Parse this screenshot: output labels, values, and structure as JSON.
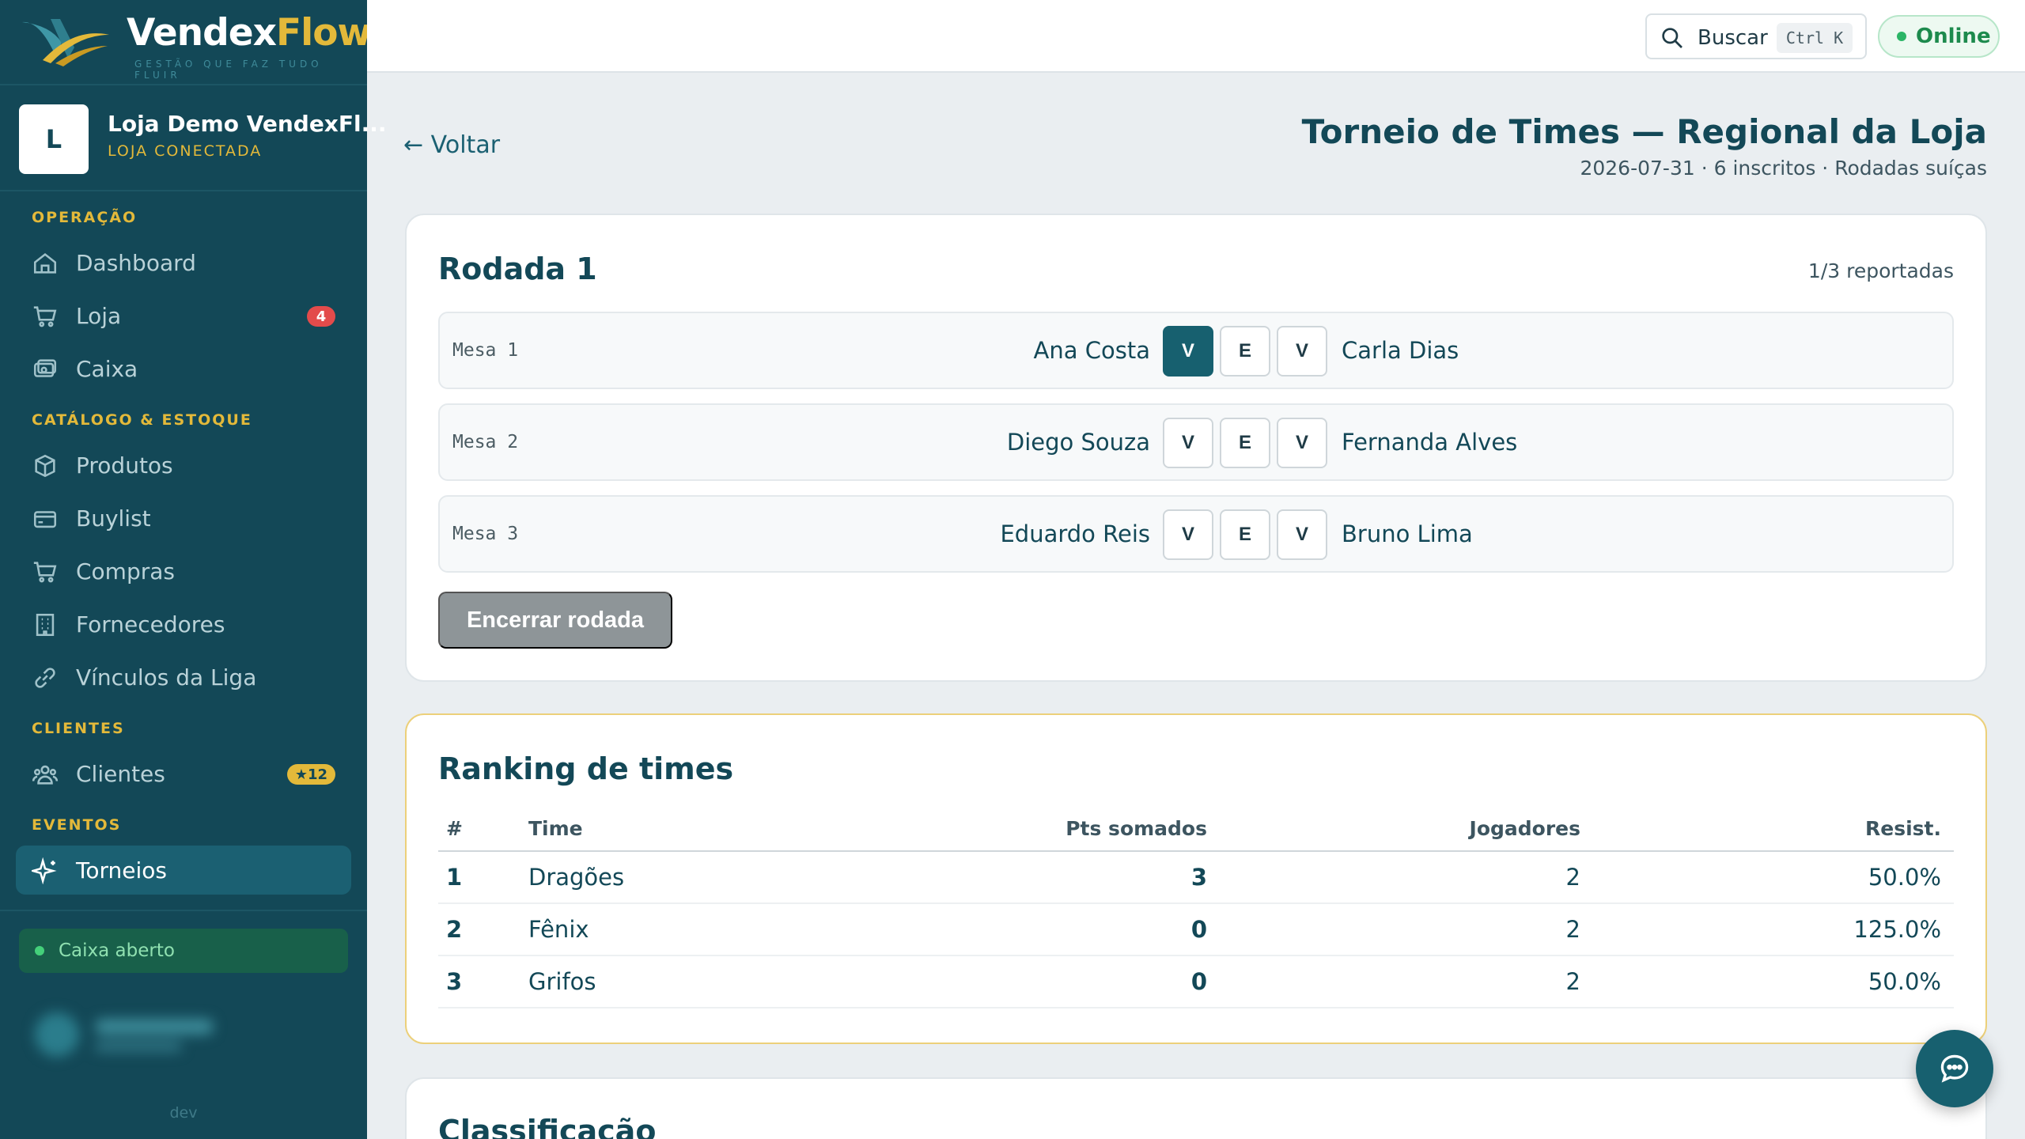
{
  "brand": {
    "name_a": "Vendex",
    "name_b": "Flow",
    "tagline": "GESTÃO QUE FAZ TUDO FLUIR"
  },
  "store": {
    "initial": "L",
    "name": "Loja Demo VendexFl...",
    "status": "LOJA CONECTADA"
  },
  "sidebar": {
    "sections": [
      "OPERAÇÃO",
      "CATÁLOGO & ESTOQUE",
      "CLIENTES",
      "EVENTOS"
    ],
    "items": [
      {
        "label": "Dashboard",
        "icon": "home-icon"
      },
      {
        "label": "Loja",
        "icon": "cart-icon",
        "badge": "4"
      },
      {
        "label": "Caixa",
        "icon": "cash-icon"
      },
      {
        "label": "Produtos",
        "icon": "box-icon"
      },
      {
        "label": "Buylist",
        "icon": "card-icon"
      },
      {
        "label": "Compras",
        "icon": "cart-icon"
      },
      {
        "label": "Fornecedores",
        "icon": "building-icon"
      },
      {
        "label": "Vínculos da Liga",
        "icon": "link-icon"
      },
      {
        "label": "Clientes",
        "icon": "users-icon",
        "badge": "★12"
      },
      {
        "label": "Torneios",
        "icon": "sparkle-icon",
        "active": true
      }
    ],
    "cash_status": "Caixa aberto",
    "env": "dev"
  },
  "topbar": {
    "search_label": "Buscar",
    "search_shortcut": "Ctrl K",
    "status": "Online"
  },
  "page": {
    "back": "← Voltar",
    "title": "Torneio de Times — Regional da Loja",
    "subtitle": "2026-07-31 · 6 inscritos · Rodadas suíças"
  },
  "round": {
    "title": "Rodada 1",
    "reported": "1/3 reportadas",
    "matches": [
      {
        "table": "Mesa 1",
        "player1": "Ana Costa",
        "player2": "Carla Dias",
        "btn1": "V",
        "btn2": "E",
        "btn3": "V",
        "selected": 1
      },
      {
        "table": "Mesa 2",
        "player1": "Diego Souza",
        "player2": "Fernanda Alves",
        "btn1": "V",
        "btn2": "E",
        "btn3": "V",
        "selected": 0
      },
      {
        "table": "Mesa 3",
        "player1": "Eduardo Reis",
        "player2": "Bruno Lima",
        "btn1": "V",
        "btn2": "E",
        "btn3": "V",
        "selected": 0
      }
    ],
    "end_button": "Encerrar rodada"
  },
  "ranking": {
    "title": "Ranking de times",
    "headers": [
      "#",
      "Time",
      "Pts somados",
      "Jogadores",
      "Resist."
    ],
    "rows": [
      {
        "pos": "1",
        "team": "Dragões",
        "points": "3",
        "players": "2",
        "resist": "50.0%"
      },
      {
        "pos": "2",
        "team": "Fênix",
        "points": "0",
        "players": "2",
        "resist": "125.0%"
      },
      {
        "pos": "3",
        "team": "Grifos",
        "points": "0",
        "players": "2",
        "resist": "50.0%"
      }
    ]
  },
  "standings": {
    "title": "Classificação"
  },
  "colors": {
    "sidebar": "#134857",
    "accent": "#17606f",
    "gold": "#e3b93a",
    "online": "#2bb566",
    "badge_red": "#e34b4b"
  }
}
